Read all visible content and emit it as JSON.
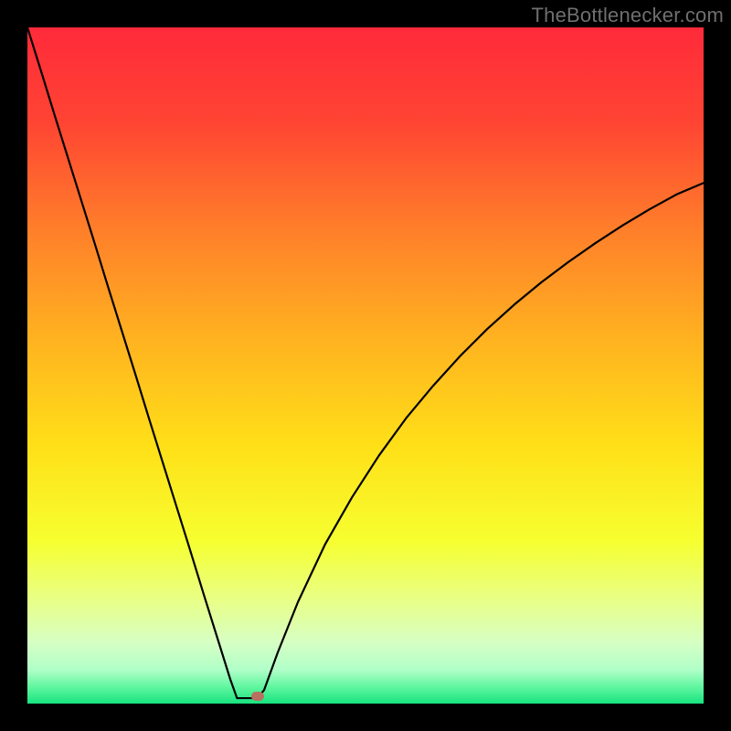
{
  "watermark": "TheBottlenecker.com",
  "chart_data": {
    "type": "line",
    "title": "",
    "xlabel": "",
    "ylabel": "",
    "xlim": [
      0,
      100
    ],
    "ylim": [
      0,
      100
    ],
    "x": [
      0,
      2,
      4,
      6,
      8,
      10,
      12,
      14,
      16,
      18,
      20,
      22,
      24,
      26,
      28,
      30,
      31,
      32,
      33,
      34,
      35,
      37,
      40,
      44,
      48,
      52,
      56,
      60,
      64,
      68,
      72,
      76,
      80,
      84,
      88,
      92,
      96,
      100
    ],
    "values": [
      100,
      93.6,
      87.1,
      80.7,
      74.3,
      67.9,
      61.4,
      55.0,
      48.6,
      42.1,
      35.7,
      29.3,
      22.9,
      16.4,
      10.0,
      3.6,
      0.8,
      0.8,
      0.8,
      0.8,
      2.0,
      7.5,
      15.0,
      23.5,
      30.5,
      36.7,
      42.2,
      47.0,
      51.4,
      55.4,
      59.0,
      62.3,
      65.3,
      68.1,
      70.7,
      73.1,
      75.3,
      77.0
    ],
    "marker": {
      "x": 34,
      "y": 1.1,
      "color": "#b87060"
    },
    "background_gradient": [
      {
        "stop": 0.0,
        "color": "#ff2a3a"
      },
      {
        "stop": 0.14,
        "color": "#ff4433"
      },
      {
        "stop": 0.3,
        "color": "#ff7f2a"
      },
      {
        "stop": 0.46,
        "color": "#ffb220"
      },
      {
        "stop": 0.62,
        "color": "#ffe018"
      },
      {
        "stop": 0.76,
        "color": "#f6ff30"
      },
      {
        "stop": 0.85,
        "color": "#e8ff8a"
      },
      {
        "stop": 0.91,
        "color": "#d6ffc4"
      },
      {
        "stop": 0.95,
        "color": "#b0ffc8"
      },
      {
        "stop": 0.975,
        "color": "#62f6a0"
      },
      {
        "stop": 1.0,
        "color": "#18e480"
      }
    ]
  }
}
